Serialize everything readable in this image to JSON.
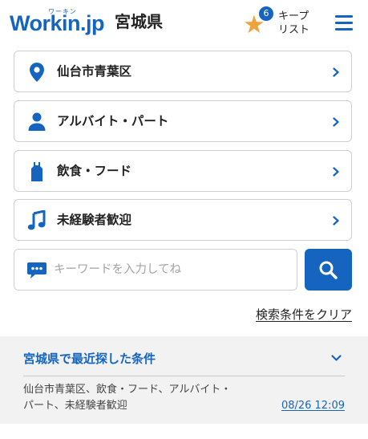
{
  "header": {
    "logo_ruby": "ワーキン",
    "logo_text": "Workin.jp",
    "prefecture": "宮城県",
    "keep_count": "6",
    "keep_label_line1": "キープ",
    "keep_label_line2": "リスト",
    "star_icon": "star-icon",
    "menu_icon": "hamburger-menu-icon"
  },
  "nav_items": [
    {
      "label": "仙台市青葉区",
      "icon": "location-pin-icon"
    },
    {
      "label": "アルバイト・パート",
      "icon": "person-icon"
    },
    {
      "label": "飲食・フード",
      "icon": "apron-icon"
    },
    {
      "label": "未経験者歓迎",
      "icon": "music-note-icon"
    }
  ],
  "search": {
    "placeholder": "キーワードを入力してね",
    "value": "",
    "chat_icon": "chat-bubble-icon",
    "button_icon": "magnifier-icon"
  },
  "clear_link": "検索条件をクリア",
  "recent": {
    "title": "宮城県で最近探した条件",
    "conditions_line1": "仙台市青葉区、飲食・フード、アルバイト・",
    "conditions_line2": "パート、未経験者歓迎",
    "date": "08/26 12:09"
  },
  "colors": {
    "primary": "#1565c0",
    "star": "#f0a23a",
    "panel_bg": "#f2f2f2",
    "border": "#cfcfcf"
  }
}
